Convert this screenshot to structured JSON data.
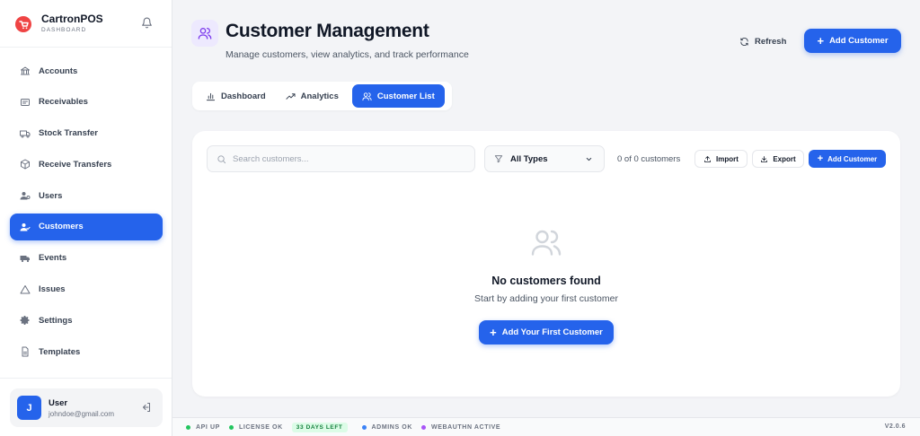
{
  "brand": {
    "name": "CartronPOS",
    "subtitle": "DASHBOARD"
  },
  "sidebar": {
    "items": [
      {
        "label": "Accounts",
        "icon": "bank-icon"
      },
      {
        "label": "Receivables",
        "icon": "receipt-icon"
      },
      {
        "label": "Stock Transfer",
        "icon": "truck-icon"
      },
      {
        "label": "Receive Transfers",
        "icon": "package-icon"
      },
      {
        "label": "Users",
        "icon": "user-gear-icon"
      },
      {
        "label": "Customers",
        "icon": "user-check-icon",
        "active": true
      },
      {
        "label": "Events",
        "icon": "truck-event-icon"
      },
      {
        "label": "Issues",
        "icon": "warning-icon"
      },
      {
        "label": "Settings",
        "icon": "gear-icon"
      },
      {
        "label": "Templates",
        "icon": "document-icon"
      }
    ]
  },
  "user": {
    "initial": "J",
    "name": "User",
    "email": "johndoe@gmail.com"
  },
  "header": {
    "title": "Customer Management",
    "subtitle": "Manage customers, view analytics, and track performance",
    "refresh_label": "Refresh",
    "add_label": "Add Customer"
  },
  "tabs": [
    {
      "label": "Dashboard"
    },
    {
      "label": "Analytics"
    },
    {
      "label": "Customer List",
      "active": true
    }
  ],
  "toolbar": {
    "search_placeholder": "Search customers...",
    "type_selected": "All Types",
    "count_text": "0 of 0 customers",
    "import_label": "Import",
    "export_label": "Export",
    "add_label": "Add Customer"
  },
  "empty_state": {
    "title": "No customers found",
    "subtitle": "Start by adding your first customer",
    "button_label": "Add Your First Customer"
  },
  "statusbar": {
    "api": "API UP",
    "license": "LICENSE OK",
    "days_left": "33 DAYS LEFT",
    "admins": "ADMINS OK",
    "webauthn": "WEBAUTHN ACTIVE",
    "version": "V2.0.6"
  },
  "colors": {
    "accent": "#2563eb",
    "status_green": "#22c55e",
    "status_blue": "#3b82f6",
    "status_purple": "#a855f7",
    "brand_red": "#ef4444"
  }
}
